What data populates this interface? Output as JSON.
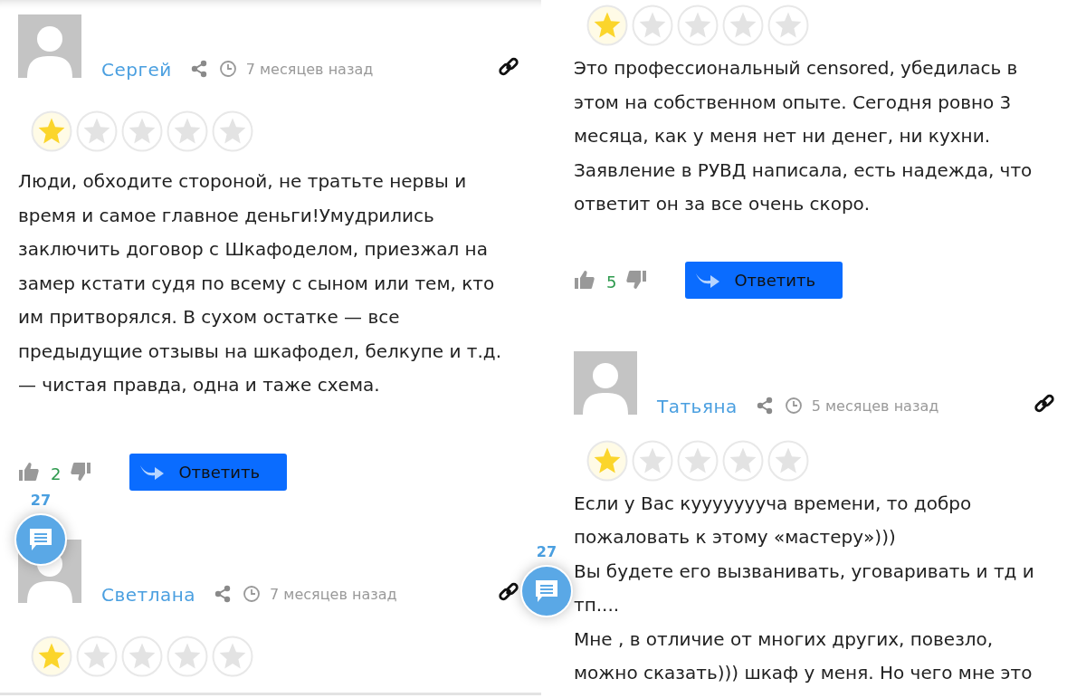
{
  "panels": [
    {
      "reviews": [
        {
          "author": "Сергей",
          "time": "7 месяцев назад",
          "stars": 1,
          "paragraphs": [
            "Люди, обходите стороной, не тратьте нервы и время и самое главное деньги!Умудрились заключить договор с Шкафоделом, приезжал на замер кстати судя по всему с сыном или тем, кто им притворялся. В сухом остатке — все предыдущие отзывы на шкафодел, белкупе и т.д. — чистая правда, одна и таже схема."
          ],
          "likes": "2",
          "reply": "Ответить"
        },
        {
          "author": "Светлана",
          "time": "7 месяцев назад",
          "stars": 1
        }
      ],
      "chat_button": {
        "count": "27"
      }
    },
    {
      "reviews": [
        {
          "stars": 1,
          "paragraphs": [
            "Это профессиональный censored, убедилась в этом на собственном опыте. Сегодня ровно 3 месяца, как у меня нет ни денег, ни кухни. Заявление в РУВД написала, есть надежда, что ответит он за все очень скоро."
          ],
          "likes": "5",
          "reply": "Ответить"
        },
        {
          "author": "Татьяна",
          "time": "5 месяцев назад",
          "stars": 1,
          "paragraphs": [
            "Если у Вас куууууууча времени, то добро пожаловать к этому «мастеру»)))",
            "Вы будете его вызванивать, уговаривать и тд и тп....",
            "Мне , в отличие от многих других, повезло, можно сказать))) шкаф у меня. Но чего мне это"
          ]
        }
      ],
      "chat_button": {
        "count": "27"
      }
    }
  ]
}
